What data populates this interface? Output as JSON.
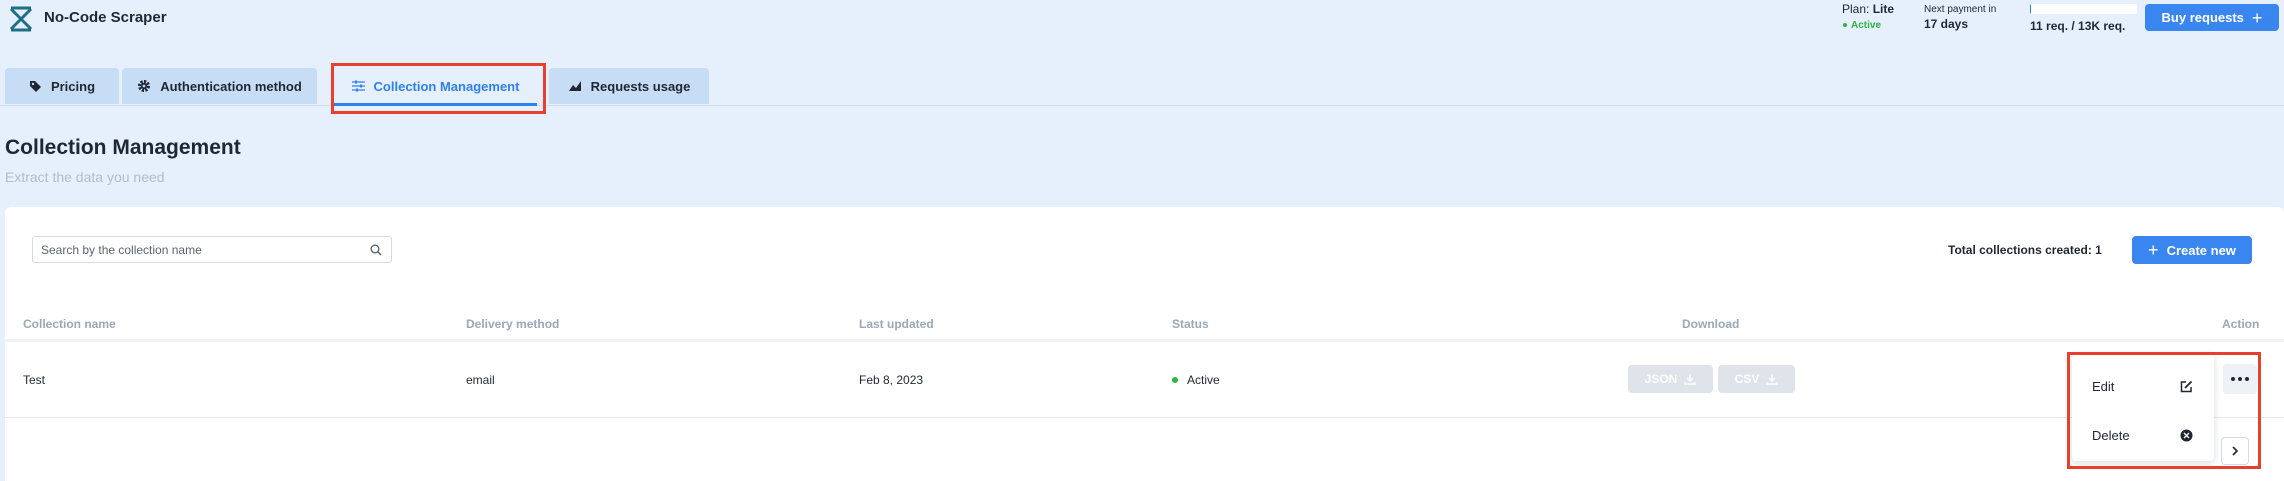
{
  "app": {
    "title": "No-Code Scraper",
    "logo_icon": "scraper-logo-icon"
  },
  "header": {
    "plan_label": "Plan:",
    "plan_name": "Lite",
    "plan_status": "Active",
    "next_payment_label": "Next payment in",
    "next_payment_value": "17 days",
    "usage_text": "11 req. / 13K req.",
    "usage_fraction": 0.0008,
    "buy_label": "Buy requests",
    "buy_icon": "plus-icon"
  },
  "tabs": [
    {
      "label": "Pricing",
      "icon": "tag-icon",
      "active": false
    },
    {
      "label": "Authentication method",
      "icon": "gear-icon",
      "active": false
    },
    {
      "label": "Collection Management",
      "icon": "sliders-icon",
      "active": true
    },
    {
      "label": "Requests usage",
      "icon": "area-chart-icon",
      "active": false
    }
  ],
  "page": {
    "title": "Collection Management",
    "subtitle": "Extract the data you need"
  },
  "toolbar": {
    "search_placeholder": "Search by the collection name",
    "search_value": "",
    "total_label": "Total collections created: 1",
    "create_label": "Create new"
  },
  "table": {
    "columns": [
      "Collection name",
      "Delivery method",
      "Last updated",
      "Status",
      "Download",
      "Action"
    ],
    "rows": [
      {
        "name": "Test",
        "delivery": "email",
        "updated": "Feb 8, 2023",
        "status": "Active",
        "downloads": [
          "JSON",
          "CSV"
        ]
      }
    ]
  },
  "action_menu": {
    "items": [
      {
        "label": "Edit",
        "icon": "edit-icon"
      },
      {
        "label": "Delete",
        "icon": "close-circle-icon"
      }
    ]
  },
  "colors": {
    "accent": "#3a86f0",
    "background": "#e6f0fc",
    "tab_inactive": "#c7dcf5",
    "status_active": "#2fb344",
    "highlight": "#e8402f"
  }
}
